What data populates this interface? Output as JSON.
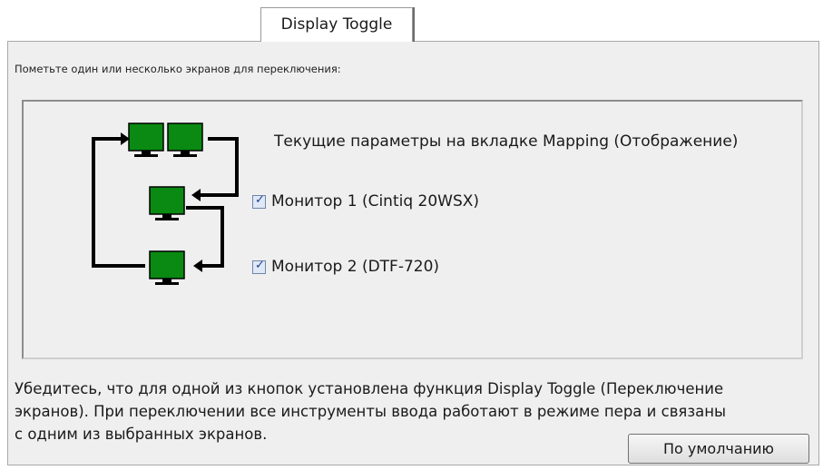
{
  "tab": {
    "label": "Display Toggle"
  },
  "instruction": "Пометьте один или несколько экранов для переключения:",
  "current_params_label": "Текущие параметры на вкладке Mapping (Отображение)",
  "monitors": [
    {
      "label": "Монитор 1 (Cintiq 20WSX)",
      "checked": true
    },
    {
      "label": "Монитор 2 (DTF-720)",
      "checked": true
    }
  ],
  "note_lines": [
    "Убедитесь, что для одной из кнопок установлена функция Display Toggle (Переключение",
    "экранов). При переключении все инструменты ввода работают в режиме пера и связаны",
    "с одним из выбранных экранов."
  ],
  "default_button": "По умолчанию",
  "colors": {
    "monitor": "#0a8a12",
    "check": "#23408e"
  }
}
